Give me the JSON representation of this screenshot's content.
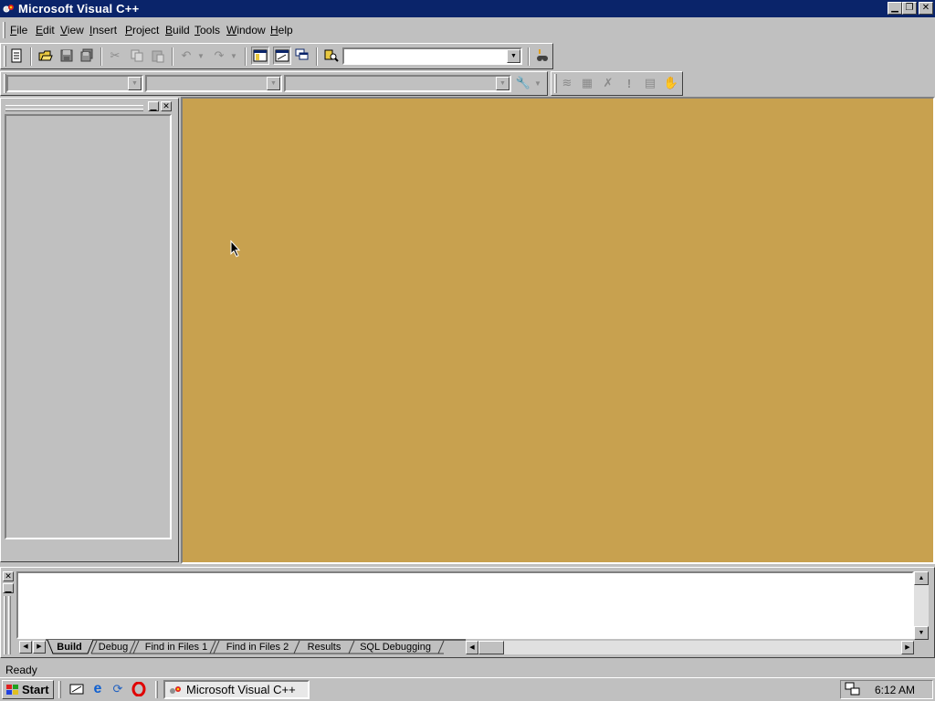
{
  "window": {
    "title": "Microsoft Visual C++",
    "controls": [
      "minimize",
      "restore",
      "close"
    ]
  },
  "menubar": {
    "items": [
      {
        "label": "File",
        "mnemonic": "F"
      },
      {
        "label": "Edit",
        "mnemonic": "E"
      },
      {
        "label": "View",
        "mnemonic": "V"
      },
      {
        "label": "Insert",
        "mnemonic": "I"
      },
      {
        "label": "Project",
        "mnemonic": "P"
      },
      {
        "label": "Build",
        "mnemonic": "B"
      },
      {
        "label": "Tools",
        "mnemonic": "T"
      },
      {
        "label": "Window",
        "mnemonic": "W"
      },
      {
        "label": "Help",
        "mnemonic": "H"
      }
    ]
  },
  "standard_toolbar": {
    "find_combo_value": "",
    "icons": [
      "new-text-file-icon",
      "open-icon",
      "save-icon",
      "save-all-icon",
      "cut-icon",
      "copy-icon",
      "paste-icon",
      "undo-icon",
      "redo-icon",
      "workspace-icon",
      "output-icon",
      "window-list-icon",
      "find-in-files-icon",
      "search-icon"
    ]
  },
  "wizard_toolbar": {
    "class_combo_value": "",
    "filter_combo_value": "",
    "members_combo_value": "",
    "icons": [
      "wizard-action-icon",
      "compile-icon",
      "build-icon",
      "stop-build-icon",
      "execute-icon",
      "go-icon",
      "breakpoint-icon"
    ]
  },
  "output": {
    "tabs": [
      "Build",
      "Debug",
      "Find in Files 1",
      "Find in Files 2",
      "Results",
      "SQL Debugging"
    ],
    "active_tab": "Build"
  },
  "statusbar": {
    "text": "Ready"
  },
  "taskbar": {
    "start_label": "Start",
    "quick_launch": [
      "show-desktop-icon",
      "internet-explorer-icon",
      "refresh-icon",
      "opera-icon"
    ],
    "task_button_label": "Microsoft Visual C++",
    "clock": "6:12 AM"
  },
  "colors": {
    "titlebar": "#0a246a",
    "mdi_background": "#c8a14f",
    "face": "#c0c0c0"
  }
}
